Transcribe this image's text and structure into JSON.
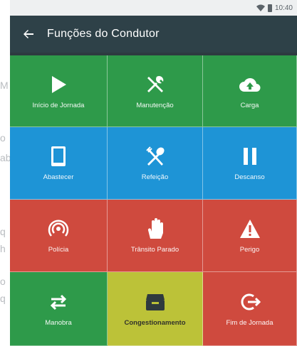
{
  "background": {
    "lines": [
      "M",
      "o",
      "ab",
      "q",
      "h",
      "o",
      "q"
    ]
  },
  "statusbar": {
    "time": "10:40"
  },
  "toolbar": {
    "back_icon": "arrow-left-icon",
    "title": "Funções do Condutor"
  },
  "tiles": [
    {
      "label": "Início de Jornada",
      "icon": "play-icon",
      "color": "#2e9a4a"
    },
    {
      "label": "Manutenção",
      "icon": "tools-icon",
      "color": "#2e9a4a"
    },
    {
      "label": "Carga",
      "icon": "cloud-upload-icon",
      "color": "#2e9a4a"
    },
    {
      "label": "Abastecer",
      "icon": "tablet-icon",
      "color": "#1e94d6"
    },
    {
      "label": "Refeição",
      "icon": "fork-spoon-icon",
      "color": "#1e94d6"
    },
    {
      "label": "Descanso",
      "icon": "pause-icon",
      "color": "#1e94d6"
    },
    {
      "label": "Polícia",
      "icon": "broadcast-icon",
      "color": "#cf4a3e"
    },
    {
      "label": "Trânsito Parado",
      "icon": "hand-icon",
      "color": "#cf4a3e"
    },
    {
      "label": "Perigo",
      "icon": "warning-icon",
      "color": "#cf4a3e"
    },
    {
      "label": "Manobra",
      "icon": "swap-icon",
      "color": "#2e9a4a"
    },
    {
      "label": "Congestionamento",
      "icon": "inbox-icon",
      "color": "#bcc238"
    },
    {
      "label": "Fim de Jornada",
      "icon": "exit-icon",
      "color": "#cf4a3e"
    }
  ]
}
